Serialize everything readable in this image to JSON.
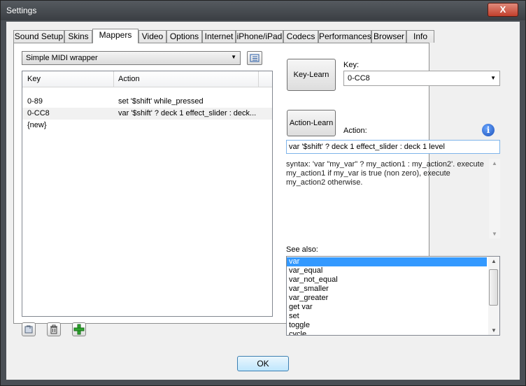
{
  "window": {
    "title": "Settings",
    "close_label": "X"
  },
  "tabs": [
    {
      "label": "Sound Setup",
      "active": false
    },
    {
      "label": "Skins",
      "active": false
    },
    {
      "label": "Mappers",
      "active": true
    },
    {
      "label": "Video",
      "active": false
    },
    {
      "label": "Options",
      "active": false
    },
    {
      "label": "Internet",
      "active": false
    },
    {
      "label": "iPhone/iPad",
      "active": false
    },
    {
      "label": "Codecs",
      "active": false
    },
    {
      "label": "Performances",
      "active": false
    },
    {
      "label": "Browser",
      "active": false
    },
    {
      "label": "Info",
      "active": false
    }
  ],
  "mapper": {
    "selected": "Simple MIDI wrapper",
    "list_icon": "list-icon"
  },
  "table": {
    "columns": [
      "Key",
      "Action"
    ],
    "rows": [
      {
        "key": "0-89",
        "action": "set '$shift' while_pressed"
      },
      {
        "key": "0-CC8",
        "action": "var '$shift' ? deck 1 effect_slider : deck..."
      },
      {
        "key": "{new}",
        "action": ""
      }
    ]
  },
  "bottom_icons": [
    "restore-icon",
    "trash-icon",
    "add-icon"
  ],
  "key_learn": {
    "label": "Key-Learn",
    "key_label": "Key:",
    "key_value": "0-CC8"
  },
  "action_learn": {
    "label": "Action-Learn",
    "action_label": "Action:",
    "action_value": "var '$shift' ? deck 1 effect_slider : deck 1 level"
  },
  "info_icon": "i",
  "syntax_text": "syntax: 'var \"my_var\" ? my_action1 : my_action2'. execute my_action1 if my_var is true (non zero), execute my_action2 otherwise.",
  "see_also": {
    "label": "See also:",
    "items": [
      "var",
      "var_equal",
      "var_not_equal",
      "var_smaller",
      "var_greater",
      "get var",
      "set",
      "toggle",
      "cycle"
    ],
    "selected": 0
  },
  "ok_label": "OK",
  "colors": {
    "selection": "#3399ff",
    "close": "#c1402c"
  }
}
